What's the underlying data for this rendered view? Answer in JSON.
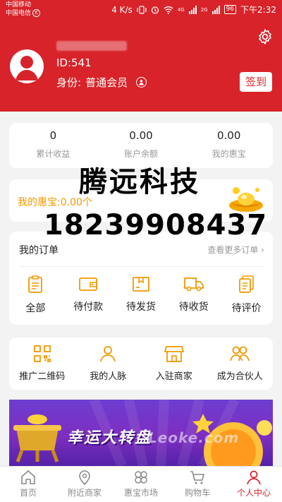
{
  "status_bar": {
    "carrier_1": "中国移动",
    "carrier_2": "中国电信",
    "carrier_badge": "K",
    "net_speed": "4 K/s",
    "network_1": "4G",
    "network_2": "2G",
    "battery": "96",
    "time": "下午2:32"
  },
  "profile": {
    "user_id": "ID:541",
    "identity_label": "身份:",
    "identity_value": "普通会员",
    "checkin_label": "签到"
  },
  "stats": [
    {
      "value": "0",
      "label": "累计收益"
    },
    {
      "value": "0.00",
      "label": "账户余额"
    },
    {
      "value": "0.00",
      "label": "我的惠宝"
    }
  ],
  "treasure": {
    "text": "我的惠宝:0.00个"
  },
  "overlay": {
    "company": "腾远科技",
    "phone": "18239908437"
  },
  "orders": {
    "title": "我的订单",
    "more": "查看更多订单 ›",
    "items": [
      {
        "label": "全部",
        "icon": "clipboard-icon"
      },
      {
        "label": "待付款",
        "icon": "wallet-icon"
      },
      {
        "label": "待发货",
        "icon": "box-icon"
      },
      {
        "label": "待收货",
        "icon": "truck-icon"
      },
      {
        "label": "待评价",
        "icon": "review-icon"
      }
    ]
  },
  "services": [
    {
      "label": "推广二维码",
      "icon": "qr-code-icon"
    },
    {
      "label": "我的人脉",
      "icon": "person-icon"
    },
    {
      "label": "入驻商家",
      "icon": "store-icon"
    },
    {
      "label": "成为合伙人",
      "icon": "partners-icon"
    }
  ],
  "banner": {
    "text": "幸运大转盘",
    "watermark": "Leoke.com"
  },
  "tabs": [
    {
      "label": "首页",
      "icon": "home-icon"
    },
    {
      "label": "附近商家",
      "icon": "location-icon"
    },
    {
      "label": "惠宝市场",
      "icon": "clover-icon"
    },
    {
      "label": "购物车",
      "icon": "cart-icon"
    },
    {
      "label": "个人中心",
      "icon": "user-icon",
      "active": true
    }
  ],
  "colors": {
    "brand_red": "#d8232a",
    "accent_orange": "#f39800",
    "banner_purple": "#6d3dd0"
  }
}
